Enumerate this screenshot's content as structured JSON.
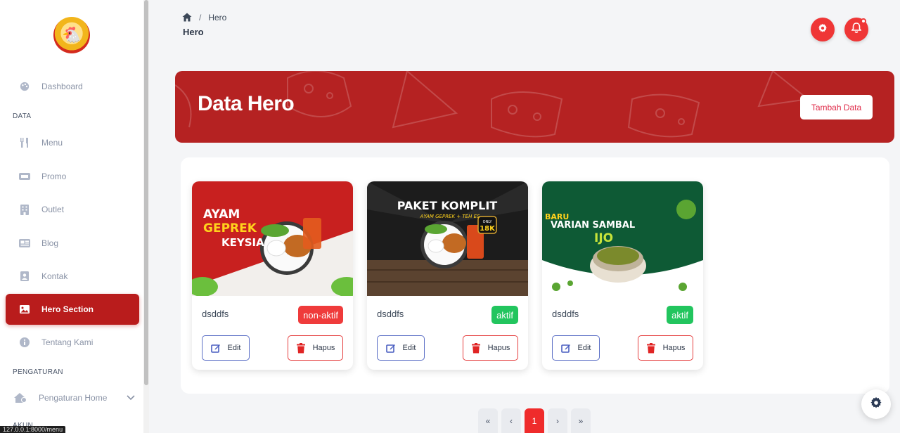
{
  "sidebar": {
    "logo_alt": "logo",
    "items": [
      {
        "label": "Dashboard",
        "icon": "palette-icon"
      },
      {
        "label": "Menu",
        "icon": "utensils-icon"
      },
      {
        "label": "Promo",
        "icon": "ticket-icon"
      },
      {
        "label": "Outlet",
        "icon": "building-icon"
      },
      {
        "label": "Blog",
        "icon": "newspaper-icon"
      },
      {
        "label": "Kontak",
        "icon": "contact-icon"
      },
      {
        "label": "Hero Section",
        "icon": "image-icon"
      },
      {
        "label": "Tentang Kami",
        "icon": "info-icon"
      },
      {
        "label": "Pengaturan Home",
        "icon": "house-gear-icon"
      }
    ],
    "sections": {
      "data": "DATA",
      "settings": "PENGATURAN",
      "account": "AKUN"
    }
  },
  "status_url": "127.0.0.1:8000/menu",
  "header": {
    "breadcrumb_current": "Hero",
    "breadcrumb_sep": "/",
    "title": "Hero"
  },
  "banner": {
    "title": "Data Hero",
    "add_button": "Tambah Data"
  },
  "cards": [
    {
      "name": "dsddfs",
      "status": "non-aktif",
      "edit": "Edit",
      "delete": "Hapus",
      "image_text": {
        "l1": "AYAM",
        "l2": "GEPREK",
        "l3": "KEYSIA"
      }
    },
    {
      "name": "dsddfs",
      "status": "aktif",
      "edit": "Edit",
      "delete": "Hapus",
      "image_text": {
        "l1": "PAKET KOMPLIT",
        "l2": "AYAM GEPREK + TEH ES",
        "price_only": "ONLY",
        "price": "18K"
      }
    },
    {
      "name": "dsddfs",
      "status": "aktif",
      "edit": "Edit",
      "delete": "Hapus",
      "image_text": {
        "l1": "BARU",
        "l2": "VARIAN SAMBAL",
        "l3": "IJO"
      }
    }
  ],
  "pagination": {
    "first": "«",
    "prev": "‹",
    "current": "1",
    "next": "›",
    "last": "»"
  },
  "colors": {
    "primary": "#b91c1c",
    "accent_red": "#ef3636",
    "success": "#22c55e"
  }
}
